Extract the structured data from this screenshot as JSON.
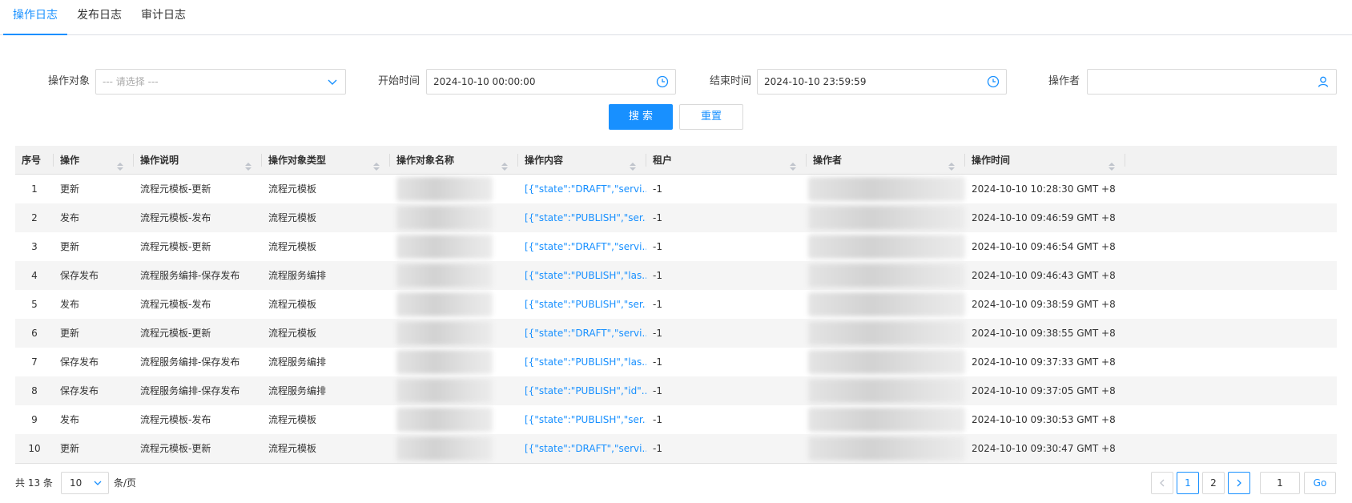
{
  "tabs": [
    {
      "label": "操作日志",
      "active": true
    },
    {
      "label": "发布日志",
      "active": false
    },
    {
      "label": "审计日志",
      "active": false
    }
  ],
  "filters": {
    "target_label": "操作对象",
    "target_placeholder": "--- 请选择 ---",
    "start_label": "开始时间",
    "start_value": "2024-10-10 00:00:00",
    "end_label": "结束时间",
    "end_value": "2024-10-10 23:59:59",
    "operator_label": "操作者",
    "operator_value": "",
    "search_label": "搜 索",
    "reset_label": "重置"
  },
  "table": {
    "columns": [
      "序号",
      "操作",
      "操作说明",
      "操作对象类型",
      "操作对象名称",
      "操作内容",
      "租户",
      "操作者",
      "操作时间"
    ],
    "rows": [
      {
        "no": "1",
        "op": "更新",
        "desc": "流程元模板-更新",
        "type": "流程元模板",
        "content": "[{\"state\":\"DRAFT\",\"servi...",
        "tenant": "-1",
        "time": "2024-10-10 10:28:30 GMT +8"
      },
      {
        "no": "2",
        "op": "发布",
        "desc": "流程元模板-发布",
        "type": "流程元模板",
        "content": "[{\"state\":\"PUBLISH\",\"ser...",
        "tenant": "-1",
        "time": "2024-10-10 09:46:59 GMT +8"
      },
      {
        "no": "3",
        "op": "更新",
        "desc": "流程元模板-更新",
        "type": "流程元模板",
        "content": "[{\"state\":\"DRAFT\",\"servi...",
        "tenant": "-1",
        "time": "2024-10-10 09:46:54 GMT +8"
      },
      {
        "no": "4",
        "op": "保存发布",
        "desc": "流程服务编排-保存发布",
        "type": "流程服务编排",
        "content": "[{\"state\":\"PUBLISH\",\"las...",
        "tenant": "-1",
        "time": "2024-10-10 09:46:43 GMT +8"
      },
      {
        "no": "5",
        "op": "发布",
        "desc": "流程元模板-发布",
        "type": "流程元模板",
        "content": "[{\"state\":\"PUBLISH\",\"ser...",
        "tenant": "-1",
        "time": "2024-10-10 09:38:59 GMT +8"
      },
      {
        "no": "6",
        "op": "更新",
        "desc": "流程元模板-更新",
        "type": "流程元模板",
        "content": "[{\"state\":\"DRAFT\",\"servi...",
        "tenant": "-1",
        "time": "2024-10-10 09:38:55 GMT +8"
      },
      {
        "no": "7",
        "op": "保存发布",
        "desc": "流程服务编排-保存发布",
        "type": "流程服务编排",
        "content": "[{\"state\":\"PUBLISH\",\"las...",
        "tenant": "-1",
        "time": "2024-10-10 09:37:33 GMT +8"
      },
      {
        "no": "8",
        "op": "保存发布",
        "desc": "流程服务编排-保存发布",
        "type": "流程服务编排",
        "content": "[{\"state\":\"PUBLISH\",\"id\"...",
        "tenant": "-1",
        "time": "2024-10-10 09:37:05 GMT +8"
      },
      {
        "no": "9",
        "op": "发布",
        "desc": "流程元模板-发布",
        "type": "流程元模板",
        "content": "[{\"state\":\"PUBLISH\",\"ser...",
        "tenant": "-1",
        "time": "2024-10-10 09:30:53 GMT +8"
      },
      {
        "no": "10",
        "op": "更新",
        "desc": "流程元模板-更新",
        "type": "流程元模板",
        "content": "[{\"state\":\"DRAFT\",\"servi...",
        "tenant": "-1",
        "time": "2024-10-10 09:30:47 GMT +8"
      }
    ]
  },
  "pagination": {
    "total_text": "共 13 条",
    "page_size": "10",
    "page_size_suffix": "条/页",
    "pages": [
      "1",
      "2"
    ],
    "current_page": "1",
    "goto_value": "1",
    "go_label": "Go"
  },
  "colors": {
    "accent": "#1890ff",
    "header_bg": "#f2f2f2",
    "stripe_bg": "#f5f5f5"
  }
}
